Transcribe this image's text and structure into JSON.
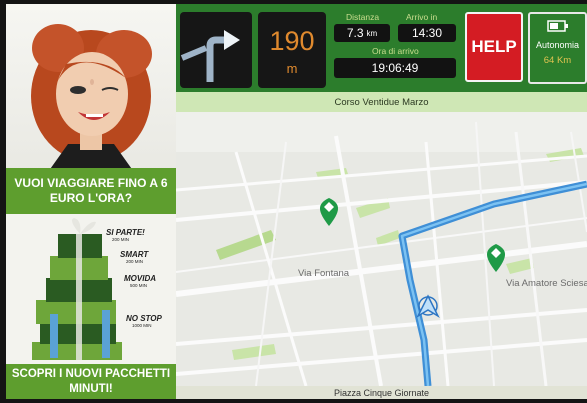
{
  "ad": {
    "headline": "VUOI VIAGGIARE FINO A 6 EURO L'ORA?",
    "packages": [
      {
        "name": "SI PARTE!",
        "minutes": "200 MIN"
      },
      {
        "name": "SMART",
        "minutes": "200 MIN"
      },
      {
        "name": "MOVIDA",
        "minutes": "500 MIN"
      },
      {
        "name": "NO STOP",
        "minutes": "1000 MIN"
      }
    ],
    "cta": "SCOPRI I NUOVI PACCHETTI MINUTI!"
  },
  "nav": {
    "turn_icon": "turn-right-arrow",
    "distance_value": "190",
    "distance_unit": "m",
    "distanza_label": "Distanza",
    "distanza_value": "7.3",
    "distanza_unit": "km",
    "arrivo_label": "Arrivo in",
    "arrivo_value": "14:30",
    "ora_label": "Ora di arrivo",
    "ora_value": "19:06:49",
    "help_label": "HELP",
    "autonomia_label": "Autonomia",
    "autonomia_value": "64 Km",
    "battery_icon": "battery-icon"
  },
  "street": {
    "current": "Corso Ventidue Marzo",
    "next": "Piazza Cinque Giornate"
  },
  "map": {
    "labels": {
      "fontana": "Via Fontana",
      "amatore": "Via Amatore Sciesa"
    },
    "poi_icon": "carrefour-icon",
    "route_color": "#49a3e6",
    "poi_color": "#1f9a47"
  },
  "colors": {
    "header_green": "#2c7d2c",
    "accent_orange": "#e08a2e",
    "help_red": "#d41c23",
    "ad_green": "#5e9e2e"
  }
}
